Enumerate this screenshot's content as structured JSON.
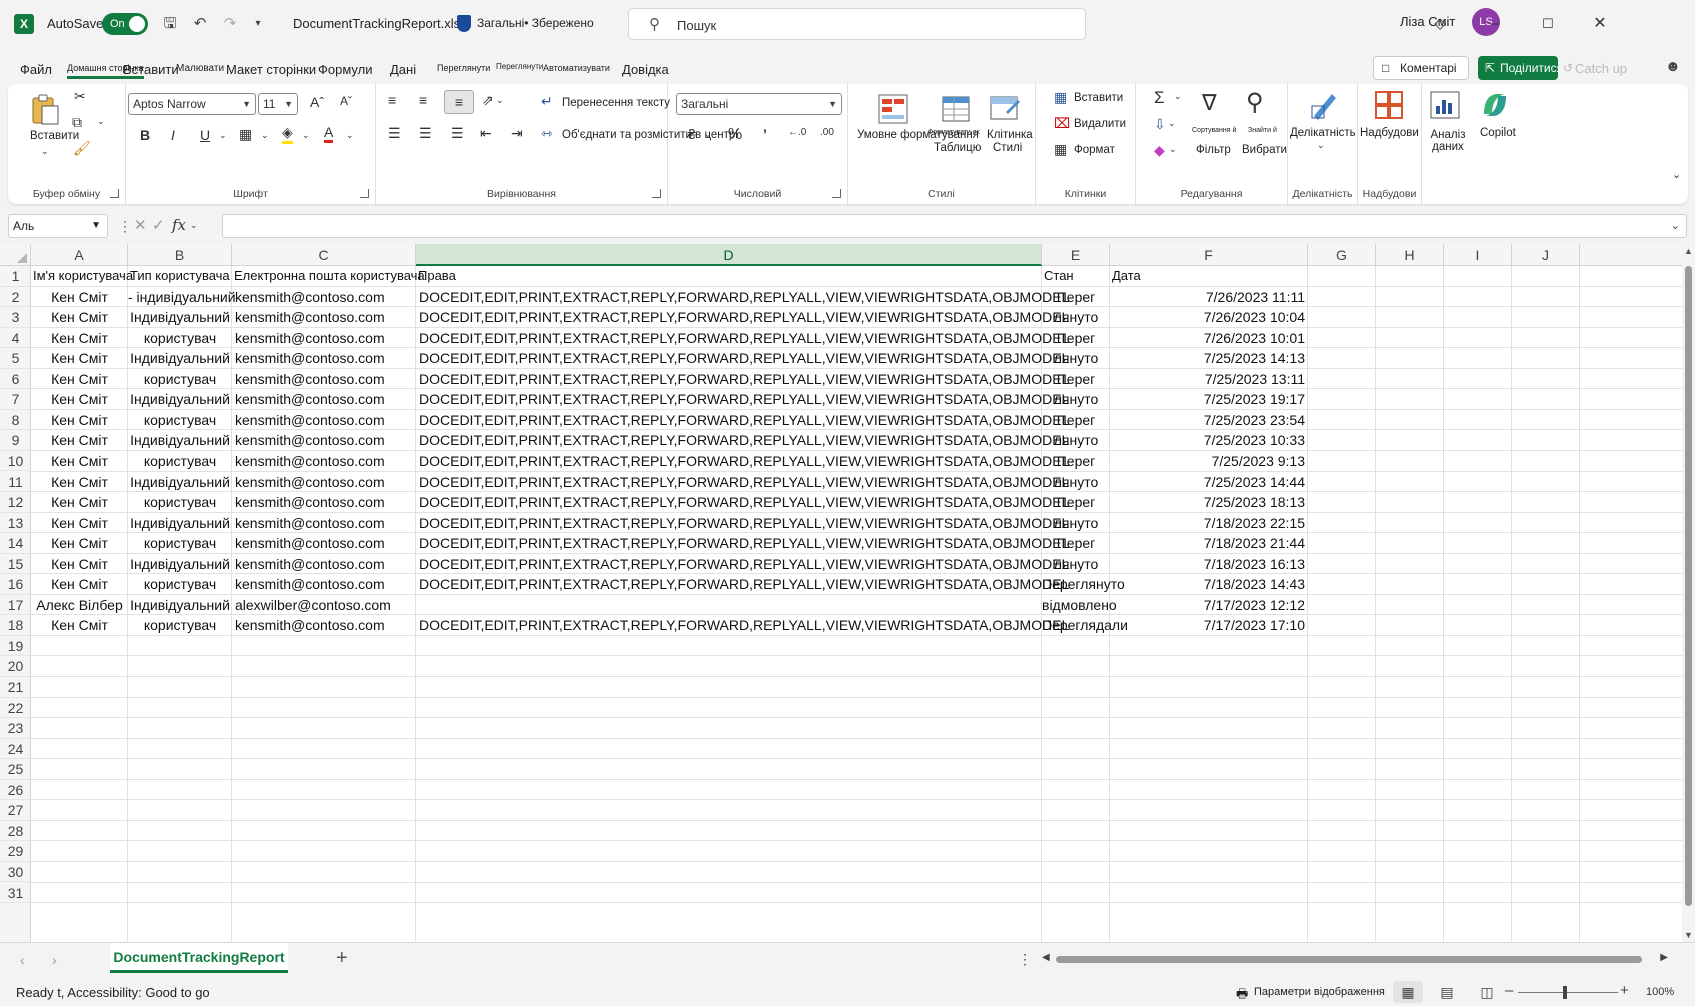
{
  "titlebar": {
    "app_icon": "excel-logo",
    "autosave_label": "AutoSave",
    "autosave_state": "On",
    "filename": "DocumentTrackingReport.xlsx",
    "sensitivity": "Загальні• Збережено",
    "search_placeholder": "Пошук",
    "user_name": "Ліза Сміт",
    "user_initials": "LS",
    "accent_color": "#107c41"
  },
  "menu": {
    "tabs": [
      "Файл",
      "Домашня сторінка",
      "Вставити",
      "Малювати",
      "Макет сторінки",
      "Формули",
      "Дані",
      "Переглянути",
      "Переглянути",
      "Автоматизувати",
      "Довідка"
    ],
    "comments": "Коментарі",
    "share": "Поділитися",
    "catchup": "Catch up"
  },
  "ribbon": {
    "clipboard": {
      "paste": "Вставити",
      "label": "Буфер обміну"
    },
    "font": {
      "name": "Aptos Narrow",
      "size": "11",
      "label": "Шрифт"
    },
    "alignment": {
      "wrap": "Перенесення тексту",
      "merge": "Об'єднати та розмістити в центрі",
      "label": "Вирівнювання"
    },
    "number": {
      "format": "Загальні",
      "label": "Числовий"
    },
    "styles": {
      "conditional": "Умовне форматування",
      "format_as_table_top": "Форматувати як",
      "format_as_table": "Таблицю",
      "cell_styles_top": "Клітинка",
      "cell_styles": "Стилі",
      "label": "Стилі"
    },
    "cells": {
      "insert": "Вставити",
      "delete": "Видалити",
      "format": "Формат",
      "label": "Клітинки"
    },
    "editing": {
      "sort_top": "Сортування й",
      "sort": "Фільтр",
      "find_top": "Знайти й",
      "find": "Вибрати",
      "label": "Редагування"
    },
    "sensitivity": {
      "btn": "Делікатність",
      "label": "Делікатність"
    },
    "addins": {
      "btn": "Надбудови",
      "label": "Надбудови"
    },
    "analyze": {
      "btn": "Аналіз даних"
    },
    "copilot": {
      "btn": "Copilot"
    }
  },
  "formula_bar": {
    "name_box": "Аль",
    "fx": "fx",
    "content": ""
  },
  "columns": [
    "A",
    "B",
    "C",
    "D",
    "E",
    "F",
    "G",
    "H",
    "I",
    "J"
  ],
  "row_numbers": [
    "1",
    "2",
    "3",
    "4",
    "5",
    "6",
    "7",
    "8",
    "9",
    "10",
    "11",
    "12",
    "13",
    "14",
    "15",
    "16",
    "17",
    "18",
    "19",
    "20",
    "21",
    "22",
    "23",
    "24",
    "25",
    "26",
    "27",
    "28",
    "29",
    "30",
    "31"
  ],
  "headers": [
    "Ім'я користувача",
    "Тип користувача",
    "Електронна пошта користувача",
    "Права",
    "Стан",
    "Дата"
  ],
  "rows": [
    [
      "Кен Сміт",
      "- індивідуальний",
      "kensmith@contoso.com",
      "DOCEDIT,EDIT,PRINT,EXTRACT,REPLY,FORWARD,REPLYALL,VIEW,VIEWRIGHTSDATA,OBJMODEL",
      "Перег",
      "7/26/2023 11:11"
    ],
    [
      "Кен Сміт",
      "Індивідуальний",
      "kensmith@contoso.com",
      "DOCEDIT,EDIT,PRINT,EXTRACT,REPLY,FORWARD,REPLYALL,VIEW,VIEWRIGHTSDATA,OBJMODEL",
      "лянуто",
      "7/26/2023 10:04"
    ],
    [
      "Кен Сміт",
      "користувач",
      "kensmith@contoso.com",
      "DOCEDIT,EDIT,PRINT,EXTRACT,REPLY,FORWARD,REPLYALL,VIEW,VIEWRIGHTSDATA,OBJMODEL",
      "Перег",
      "7/26/2023 10:01"
    ],
    [
      "Кен Сміт",
      "Індивідуальний",
      "kensmith@contoso.com",
      "DOCEDIT,EDIT,PRINT,EXTRACT,REPLY,FORWARD,REPLYALL,VIEW,VIEWRIGHTSDATA,OBJMODEL",
      "лянуто",
      "7/25/2023 14:13"
    ],
    [
      "Кен Сміт",
      "користувач",
      "kensmith@contoso.com",
      "DOCEDIT,EDIT,PRINT,EXTRACT,REPLY,FORWARD,REPLYALL,VIEW,VIEWRIGHTSDATA,OBJMODEL",
      "Перег",
      "7/25/2023 13:11"
    ],
    [
      "Кен Сміт",
      "Індивідуальний",
      "kensmith@contoso.com",
      "DOCEDIT,EDIT,PRINT,EXTRACT,REPLY,FORWARD,REPLYALL,VIEW,VIEWRIGHTSDATA,OBJMODEL",
      "лянуто",
      "7/25/2023 19:17"
    ],
    [
      "Кен Сміт",
      "користувач",
      "kensmith@contoso.com",
      "DOCEDIT,EDIT,PRINT,EXTRACT,REPLY,FORWARD,REPLYALL,VIEW,VIEWRIGHTSDATA,OBJMODEL",
      "Перег",
      "7/25/2023 23:54"
    ],
    [
      "Кен Сміт",
      "Індивідуальний",
      "kensmith@contoso.com",
      "DOCEDIT,EDIT,PRINT,EXTRACT,REPLY,FORWARD,REPLYALL,VIEW,VIEWRIGHTSDATA,OBJMODEL",
      "лянуто",
      "7/25/2023 10:33"
    ],
    [
      "Кен Сміт",
      "користувач",
      "kensmith@contoso.com",
      "DOCEDIT,EDIT,PRINT,EXTRACT,REPLY,FORWARD,REPLYALL,VIEW,VIEWRIGHTSDATA,OBJMODEL",
      "Перег",
      "7/25/2023 9:13"
    ],
    [
      "Кен Сміт",
      "Індивідуальний",
      "kensmith@contoso.com",
      "DOCEDIT,EDIT,PRINT,EXTRACT,REPLY,FORWARD,REPLYALL,VIEW,VIEWRIGHTSDATA,OBJMODEL",
      "лянуто",
      "7/25/2023 14:44"
    ],
    [
      "Кен Сміт",
      "користувач",
      "kensmith@contoso.com",
      "DOCEDIT,EDIT,PRINT,EXTRACT,REPLY,FORWARD,REPLYALL,VIEW,VIEWRIGHTSDATA,OBJMODEL",
      "Перег",
      "7/25/2023 18:13"
    ],
    [
      "Кен Сміт",
      "Індивідуальний",
      "kensmith@contoso.com",
      "DOCEDIT,EDIT,PRINT,EXTRACT,REPLY,FORWARD,REPLYALL,VIEW,VIEWRIGHTSDATA,OBJMODEL",
      "лянуто",
      "7/18/2023 22:15"
    ],
    [
      "Кен Сміт",
      "користувач",
      "kensmith@contoso.com",
      "DOCEDIT,EDIT,PRINT,EXTRACT,REPLY,FORWARD,REPLYALL,VIEW,VIEWRIGHTSDATA,OBJMODEL",
      "Перег",
      "7/18/2023 21:44"
    ],
    [
      "Кен Сміт",
      "Індивідуальний",
      "kensmith@contoso.com",
      "DOCEDIT,EDIT,PRINT,EXTRACT,REPLY,FORWARD,REPLYALL,VIEW,VIEWRIGHTSDATA,OBJMODEL",
      "лянуто",
      "7/18/2023 16:13"
    ],
    [
      "Кен Сміт",
      "користувач",
      "kensmith@contoso.com",
      "DOCEDIT,EDIT,PRINT,EXTRACT,REPLY,FORWARD,REPLYALL,VIEW,VIEWRIGHTSDATA,OBJMODEL",
      "Переглянуто",
      "7/18/2023 14:43"
    ],
    [
      "Алекс Вілбер",
      "Індивідуальний",
      "alexwilber@contoso.com",
      "",
      "відмовлено",
      "7/17/2023 12:12"
    ],
    [
      "Кен Сміт",
      "користувач",
      "kensmith@contoso.com",
      "DOCEDIT,EDIT,PRINT,EXTRACT,REPLY,FORWARD,REPLYALL,VIEW,VIEWRIGHTSDATA,OBJMODEL",
      "Переглядали",
      "7/17/2023 17:10"
    ]
  ],
  "sheet_tabs": [
    "DocumentTrackingReport"
  ],
  "status": {
    "text": "Ready t, Accessibility: Good to go",
    "display_settings": "Параметри відображення",
    "zoom": "100%"
  }
}
